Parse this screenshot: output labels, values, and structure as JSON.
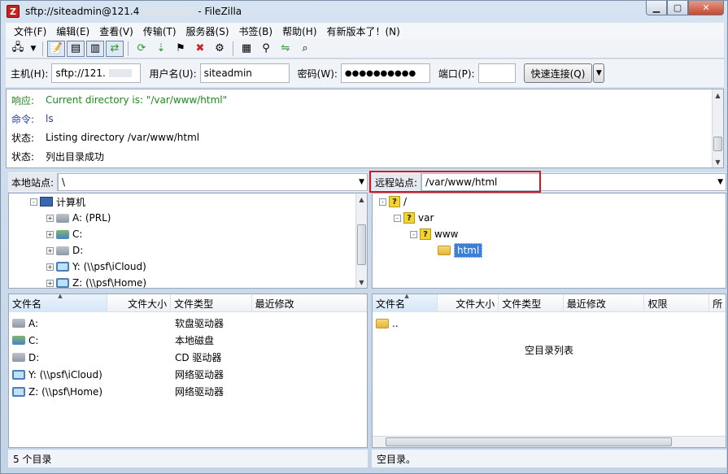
{
  "window": {
    "title": "sftp://siteadmin@121.4",
    "title_suffix": "- FileZilla",
    "app_icon": "Z"
  },
  "menu": [
    "文件(F)",
    "编辑(E)",
    "查看(V)",
    "传输(T)",
    "服务器(S)",
    "书签(B)",
    "帮助(H)",
    "有新版本了！(N)"
  ],
  "toolbar": {
    "icons": [
      "site-manager-icon",
      "dropdown-icon",
      "toggle-log-icon",
      "toggle-local-tree-icon",
      "toggle-remote-tree-icon",
      "toggle-queue-icon",
      "refresh-icon",
      "process-queue-icon",
      "cancel-icon",
      "disconnect-icon",
      "reconnect-icon",
      "filter-icon",
      "compare-icon",
      "sync-browse-icon",
      "search-icon"
    ]
  },
  "quickconnect": {
    "host_label": "主机(H):",
    "host_value": "sftp://121.",
    "user_label": "用户名(U):",
    "user_value": "siteadmin",
    "pass_label": "密码(W):",
    "pass_value": "●●●●●●●●●●",
    "port_label": "端口(P):",
    "port_value": "",
    "connect_label": "快速连接(Q)"
  },
  "log": [
    {
      "type": "响应:",
      "text": "Current directory is: \"/var/www/html\"",
      "color": "green"
    },
    {
      "type": "命令:",
      "text": "ls",
      "color": "blue"
    },
    {
      "type": "状态:",
      "text": "Listing directory /var/www/html",
      "color": "black"
    },
    {
      "type": "状态:",
      "text": "列出目录成功",
      "color": "black"
    }
  ],
  "local": {
    "site_label": "本地站点:",
    "path": "\\",
    "tree": [
      {
        "label": "计算机",
        "icon": "computer-icon",
        "expander": "-"
      },
      {
        "label": "A: (PRL)",
        "icon": "drive-icon",
        "expander": "+"
      },
      {
        "label": "C:",
        "icon": "disk-icon",
        "expander": "+"
      },
      {
        "label": "D:",
        "icon": "cd-drive-icon",
        "expander": "+"
      },
      {
        "label": "Y: (\\\\psf\\iCloud)",
        "icon": "network-drive-icon",
        "expander": "+"
      },
      {
        "label": "Z: (\\\\psf\\Home)",
        "icon": "network-drive-icon",
        "expander": "+"
      }
    ],
    "columns": [
      "文件名",
      "文件大小",
      "文件类型",
      "最近修改"
    ],
    "rows": [
      {
        "name": "A:",
        "type": "软盘驱动器",
        "icon": "drive-icon"
      },
      {
        "name": "C:",
        "type": "本地磁盘",
        "icon": "disk-icon"
      },
      {
        "name": "D:",
        "type": "CD 驱动器",
        "icon": "cd-drive-icon"
      },
      {
        "name": "Y: (\\\\psf\\iCloud)",
        "type": "网络驱动器",
        "icon": "network-drive-icon"
      },
      {
        "name": "Z: (\\\\psf\\Home)",
        "type": "网络驱动器",
        "icon": "network-drive-icon"
      }
    ],
    "status": "5 个目录"
  },
  "remote": {
    "site_label": "远程站点:",
    "path": "/var/www/html",
    "tree": [
      {
        "label": "/",
        "icon": "unknown-folder-icon",
        "expander": "-"
      },
      {
        "label": "var",
        "icon": "unknown-folder-icon",
        "expander": "-"
      },
      {
        "label": "www",
        "icon": "unknown-folder-icon",
        "expander": "-"
      },
      {
        "label": "html",
        "icon": "folder-icon",
        "expander": ""
      }
    ],
    "columns": [
      "文件名",
      "文件大小",
      "文件类型",
      "最近修改",
      "权限",
      "所"
    ],
    "rows": [
      {
        "name": "..",
        "icon": "folder-icon"
      }
    ],
    "empty_text": "空目录列表",
    "status": "空目录。"
  },
  "colors": {
    "highlight": "#d9141a",
    "selection": "#3b7ed9",
    "log_green": "#1d8a1d",
    "log_blue": "#1e3eb2"
  }
}
